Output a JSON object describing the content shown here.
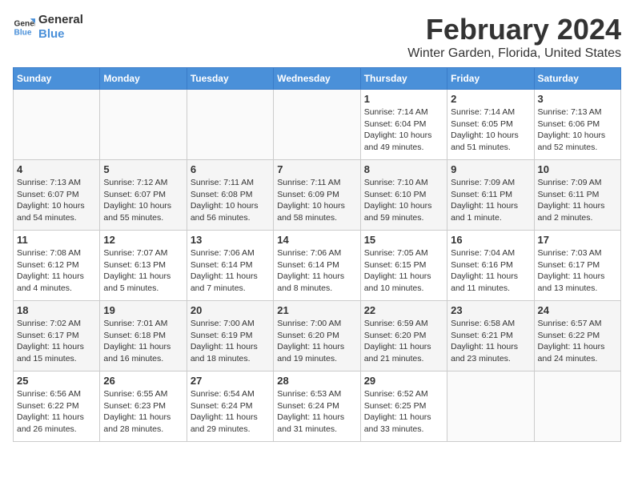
{
  "header": {
    "logo_line1": "General",
    "logo_line2": "Blue",
    "main_title": "February 2024",
    "sub_title": "Winter Garden, Florida, United States"
  },
  "days_of_week": [
    "Sunday",
    "Monday",
    "Tuesday",
    "Wednesday",
    "Thursday",
    "Friday",
    "Saturday"
  ],
  "weeks": [
    [
      {
        "day": "",
        "text": ""
      },
      {
        "day": "",
        "text": ""
      },
      {
        "day": "",
        "text": ""
      },
      {
        "day": "",
        "text": ""
      },
      {
        "day": "1",
        "text": "Sunrise: 7:14 AM\nSunset: 6:04 PM\nDaylight: 10 hours and 49 minutes."
      },
      {
        "day": "2",
        "text": "Sunrise: 7:14 AM\nSunset: 6:05 PM\nDaylight: 10 hours and 51 minutes."
      },
      {
        "day": "3",
        "text": "Sunrise: 7:13 AM\nSunset: 6:06 PM\nDaylight: 10 hours and 52 minutes."
      }
    ],
    [
      {
        "day": "4",
        "text": "Sunrise: 7:13 AM\nSunset: 6:07 PM\nDaylight: 10 hours and 54 minutes."
      },
      {
        "day": "5",
        "text": "Sunrise: 7:12 AM\nSunset: 6:07 PM\nDaylight: 10 hours and 55 minutes."
      },
      {
        "day": "6",
        "text": "Sunrise: 7:11 AM\nSunset: 6:08 PM\nDaylight: 10 hours and 56 minutes."
      },
      {
        "day": "7",
        "text": "Sunrise: 7:11 AM\nSunset: 6:09 PM\nDaylight: 10 hours and 58 minutes."
      },
      {
        "day": "8",
        "text": "Sunrise: 7:10 AM\nSunset: 6:10 PM\nDaylight: 10 hours and 59 minutes."
      },
      {
        "day": "9",
        "text": "Sunrise: 7:09 AM\nSunset: 6:11 PM\nDaylight: 11 hours and 1 minute."
      },
      {
        "day": "10",
        "text": "Sunrise: 7:09 AM\nSunset: 6:11 PM\nDaylight: 11 hours and 2 minutes."
      }
    ],
    [
      {
        "day": "11",
        "text": "Sunrise: 7:08 AM\nSunset: 6:12 PM\nDaylight: 11 hours and 4 minutes."
      },
      {
        "day": "12",
        "text": "Sunrise: 7:07 AM\nSunset: 6:13 PM\nDaylight: 11 hours and 5 minutes."
      },
      {
        "day": "13",
        "text": "Sunrise: 7:06 AM\nSunset: 6:14 PM\nDaylight: 11 hours and 7 minutes."
      },
      {
        "day": "14",
        "text": "Sunrise: 7:06 AM\nSunset: 6:14 PM\nDaylight: 11 hours and 8 minutes."
      },
      {
        "day": "15",
        "text": "Sunrise: 7:05 AM\nSunset: 6:15 PM\nDaylight: 11 hours and 10 minutes."
      },
      {
        "day": "16",
        "text": "Sunrise: 7:04 AM\nSunset: 6:16 PM\nDaylight: 11 hours and 11 minutes."
      },
      {
        "day": "17",
        "text": "Sunrise: 7:03 AM\nSunset: 6:17 PM\nDaylight: 11 hours and 13 minutes."
      }
    ],
    [
      {
        "day": "18",
        "text": "Sunrise: 7:02 AM\nSunset: 6:17 PM\nDaylight: 11 hours and 15 minutes."
      },
      {
        "day": "19",
        "text": "Sunrise: 7:01 AM\nSunset: 6:18 PM\nDaylight: 11 hours and 16 minutes."
      },
      {
        "day": "20",
        "text": "Sunrise: 7:00 AM\nSunset: 6:19 PM\nDaylight: 11 hours and 18 minutes."
      },
      {
        "day": "21",
        "text": "Sunrise: 7:00 AM\nSunset: 6:20 PM\nDaylight: 11 hours and 19 minutes."
      },
      {
        "day": "22",
        "text": "Sunrise: 6:59 AM\nSunset: 6:20 PM\nDaylight: 11 hours and 21 minutes."
      },
      {
        "day": "23",
        "text": "Sunrise: 6:58 AM\nSunset: 6:21 PM\nDaylight: 11 hours and 23 minutes."
      },
      {
        "day": "24",
        "text": "Sunrise: 6:57 AM\nSunset: 6:22 PM\nDaylight: 11 hours and 24 minutes."
      }
    ],
    [
      {
        "day": "25",
        "text": "Sunrise: 6:56 AM\nSunset: 6:22 PM\nDaylight: 11 hours and 26 minutes."
      },
      {
        "day": "26",
        "text": "Sunrise: 6:55 AM\nSunset: 6:23 PM\nDaylight: 11 hours and 28 minutes."
      },
      {
        "day": "27",
        "text": "Sunrise: 6:54 AM\nSunset: 6:24 PM\nDaylight: 11 hours and 29 minutes."
      },
      {
        "day": "28",
        "text": "Sunrise: 6:53 AM\nSunset: 6:24 PM\nDaylight: 11 hours and 31 minutes."
      },
      {
        "day": "29",
        "text": "Sunrise: 6:52 AM\nSunset: 6:25 PM\nDaylight: 11 hours and 33 minutes."
      },
      {
        "day": "",
        "text": ""
      },
      {
        "day": "",
        "text": ""
      }
    ]
  ]
}
